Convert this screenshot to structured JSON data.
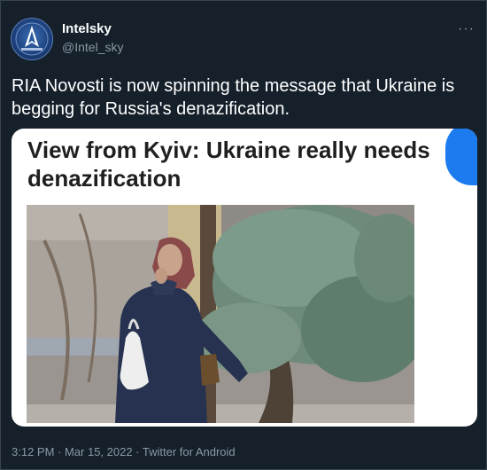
{
  "tweet": {
    "author_name": "Intelsky",
    "author_handle": "@Intel_sky",
    "more_label": "···",
    "text": "RIA Novosti is now spinning the message that Ukraine is begging for Russia's denazification.",
    "timestamp": "3:12 PM · Mar 15, 2022 · Twitter for Android"
  },
  "media": {
    "headline": "View from Kyiv: Ukraine really needs denazification"
  },
  "icons": {
    "avatar": "intelsky-logo-icon",
    "more": "more-options-icon"
  },
  "colors": {
    "background": "#15202b",
    "secondary_text": "#8b98a5",
    "accent_blue": "#1d7bf0"
  }
}
